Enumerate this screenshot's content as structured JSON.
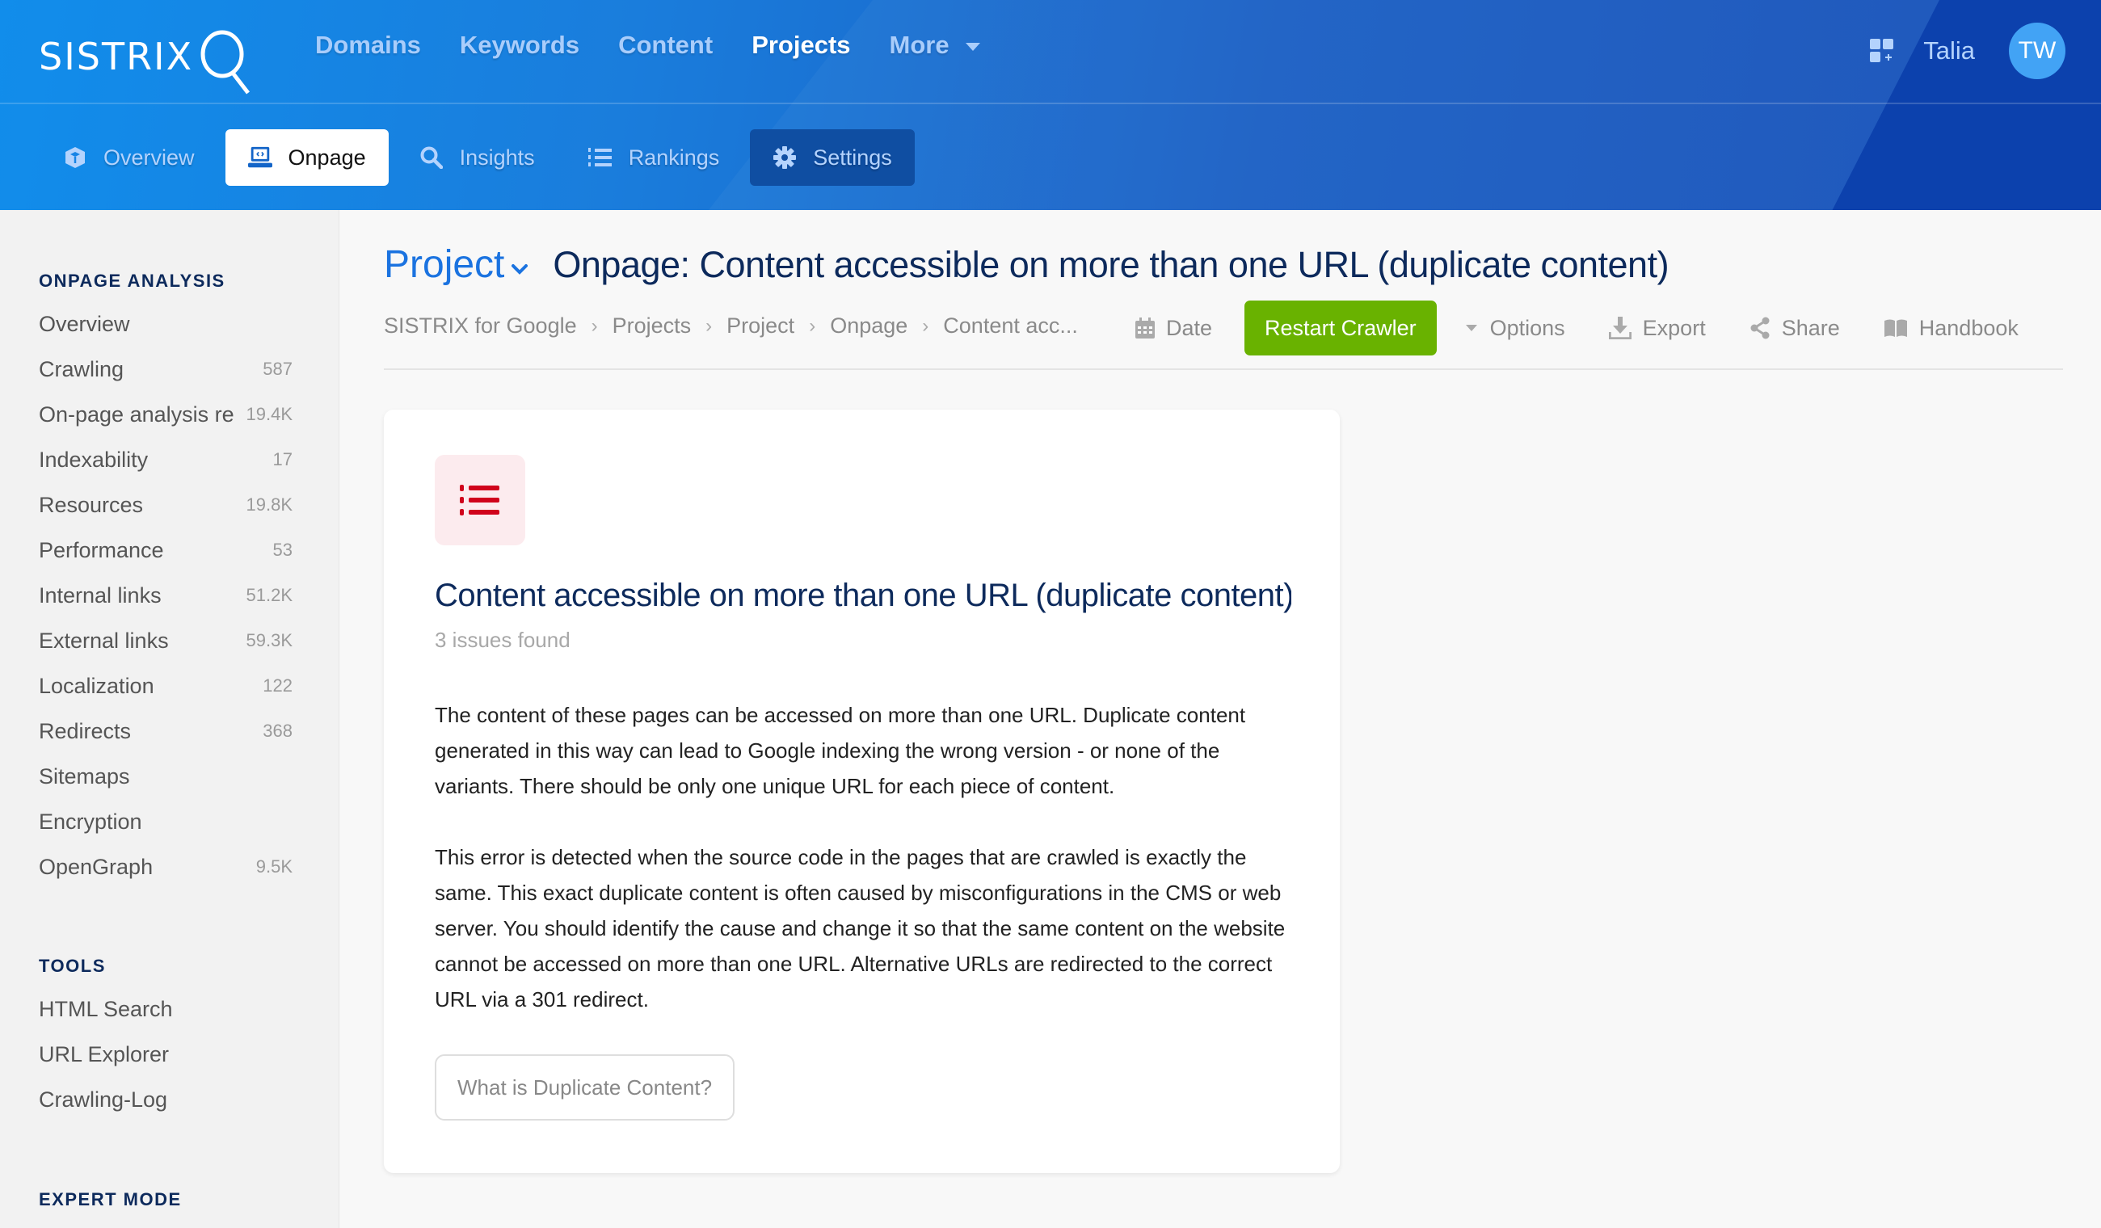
{
  "header": {
    "logo_text": "SISTRIX",
    "nav": [
      {
        "label": "Domains",
        "active": false
      },
      {
        "label": "Keywords",
        "active": false
      },
      {
        "label": "Content",
        "active": false
      },
      {
        "label": "Projects",
        "active": true
      },
      {
        "label": "More",
        "active": false
      }
    ],
    "user_name": "Talia",
    "avatar_initials": "TW",
    "apps_icon": "apps-add-icon"
  },
  "subnav": [
    {
      "label": "Overview",
      "icon": "cube-icon",
      "state": "normal"
    },
    {
      "label": "Onpage",
      "icon": "laptop-code-icon",
      "state": "active"
    },
    {
      "label": "Insights",
      "icon": "search-icon",
      "state": "normal"
    },
    {
      "label": "Rankings",
      "icon": "ordered-list-icon",
      "state": "normal"
    },
    {
      "label": "Settings",
      "icon": "gear-icon",
      "state": "highlighted"
    }
  ],
  "sidebar": {
    "sections": [
      {
        "heading": "ONPAGE ANALYSIS",
        "items": [
          {
            "label": "Overview",
            "count": ""
          },
          {
            "label": "Crawling",
            "count": "587"
          },
          {
            "label": "On-page analysis re",
            "count": "19.4K"
          },
          {
            "label": "Indexability",
            "count": "17"
          },
          {
            "label": "Resources",
            "count": "19.8K"
          },
          {
            "label": "Performance",
            "count": "53"
          },
          {
            "label": "Internal links",
            "count": "51.2K"
          },
          {
            "label": "External links",
            "count": "59.3K"
          },
          {
            "label": "Localization",
            "count": "122"
          },
          {
            "label": "Redirects",
            "count": "368"
          },
          {
            "label": "Sitemaps",
            "count": ""
          },
          {
            "label": "Encryption",
            "count": ""
          },
          {
            "label": "OpenGraph",
            "count": "9.5K"
          }
        ]
      },
      {
        "heading": "TOOLS",
        "items": [
          {
            "label": "HTML Search",
            "count": ""
          },
          {
            "label": "URL Explorer",
            "count": ""
          },
          {
            "label": "Crawling-Log",
            "count": ""
          }
        ]
      },
      {
        "heading": "EXPERT MODE",
        "items": []
      }
    ]
  },
  "page": {
    "project_link": "Project",
    "title": "Onpage: Content accessible on more than one URL (duplicate content)",
    "breadcrumb": [
      "SISTRIX for Google",
      "Projects",
      "Project",
      "Onpage",
      "Content acc..."
    ],
    "toolbar": {
      "date": "Date",
      "restart": "Restart Crawler",
      "options": "Options",
      "export": "Export",
      "share": "Share",
      "handbook": "Handbook"
    },
    "colors": {
      "accent_blue": "#1b73e0",
      "restart_green": "#69b200",
      "issue_red": "#d0021b",
      "title_navy": "#0d2a5c"
    }
  },
  "card": {
    "icon": "list-icon",
    "title": "Content accessible on more than one URL (duplicate content)",
    "subtitle": "3 issues found",
    "paragraphs": [
      "The content of these pages can be accessed on more than one URL. Duplicate content generated in this way can lead to Google indexing the wrong version - or none of the variants. There should be only one unique URL for each piece of content.",
      "This error is detected when the source code in the pages that are crawled is exactly the same. This exact duplicate content is often caused by misconfigurations in the CMS or web server. You should identify the cause and change it so that the same content on the website cannot be accessed on more than one URL. Alternative URLs are redirected to the correct URL via a 301 redirect."
    ],
    "button": "What is Duplicate Content?"
  }
}
